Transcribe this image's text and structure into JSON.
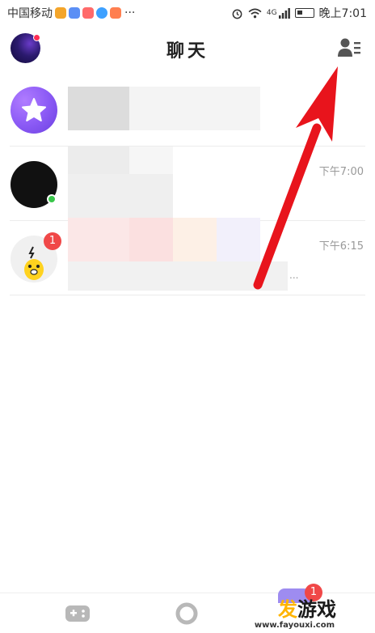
{
  "status_bar": {
    "carrier": "中国移动",
    "more": "···",
    "network": "4G",
    "time": "晚上7:01"
  },
  "header": {
    "title": "聊天"
  },
  "chats": [
    {
      "time": ""
    },
    {
      "time": "下午7:00"
    },
    {
      "time": "下午6:15",
      "unread": "1",
      "preview_ellipsis": "..."
    }
  ],
  "bottom_nav": {
    "badge": "1",
    "watermark_text": "发游戏",
    "watermark_url": "www.fayouxi.com"
  },
  "colors": {
    "annotation_arrow": "#e8141c",
    "badge": "#f04848",
    "online": "#38c64a",
    "watermark_accent": "#ffb400"
  },
  "icons": [
    "alarm-icon",
    "wifi-icon",
    "signal-icon",
    "battery-icon",
    "contacts-icon",
    "star-icon",
    "game-controller-icon",
    "circle-icon"
  ]
}
